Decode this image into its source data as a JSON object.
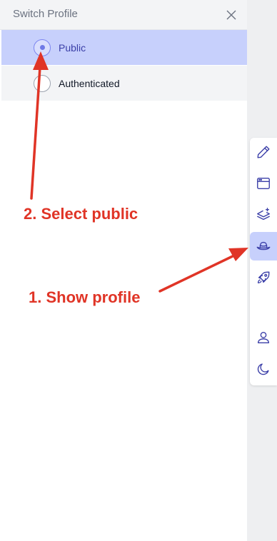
{
  "panel": {
    "title": "Switch Profile",
    "options": [
      {
        "label": "Public",
        "selected": true
      },
      {
        "label": "Authenticated",
        "selected": false
      }
    ]
  },
  "toolbar": {
    "items": [
      {
        "icon": "pencil-icon"
      },
      {
        "icon": "browser-window-icon"
      },
      {
        "icon": "layers-plus-icon"
      },
      {
        "icon": "hat-icon",
        "active": true
      },
      {
        "icon": "rocket-icon"
      },
      {
        "icon": "user-icon"
      },
      {
        "icon": "moon-icon"
      }
    ]
  },
  "annotations": {
    "step1": "1. Show profile",
    "step2": "2. Select public"
  },
  "colors": {
    "accent": "#c7d0fc",
    "icon": "#3b3fa8",
    "annotation": "#e03426"
  }
}
